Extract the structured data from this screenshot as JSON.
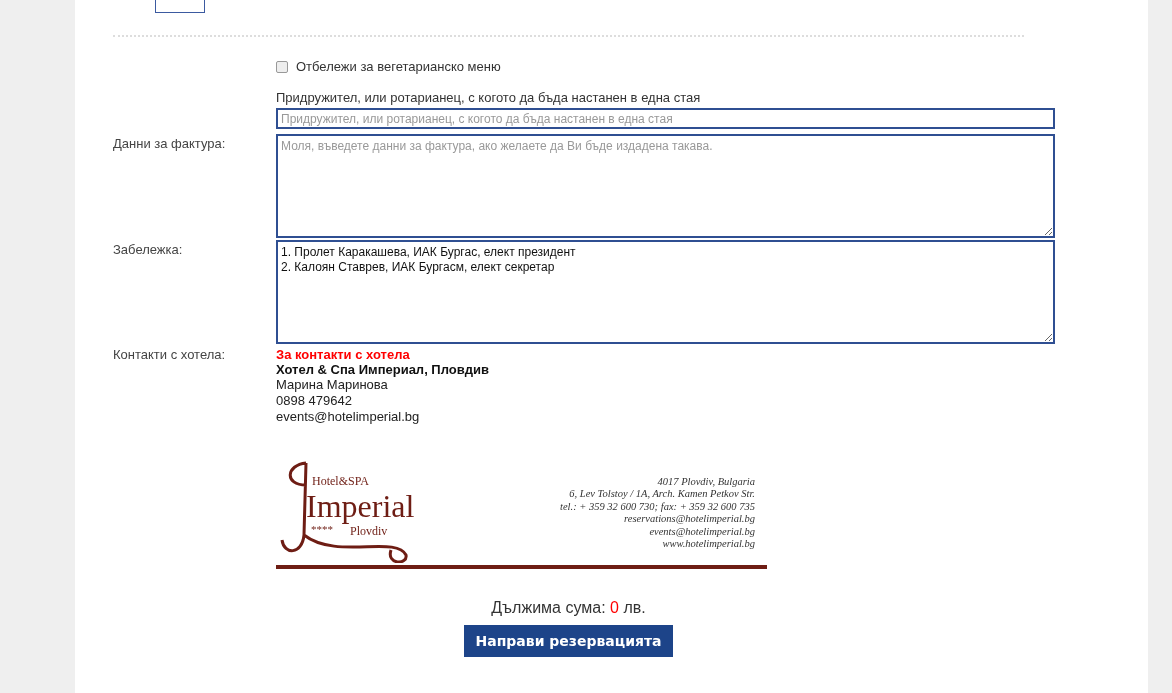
{
  "vegetarian": {
    "label": "Отбележи за вегетарианско меню",
    "checked": false
  },
  "roommate": {
    "label": "Придружител, или ротарианец, с когото да бъда настанен в една стая",
    "placeholder": "Придружител, или ротарианец, с когото да бъда настанен в една стая"
  },
  "invoice": {
    "label": "Данни за фактура:",
    "placeholder": "Моля, въведете данни за фактура, ако желаете да Ви бъде издадена такава."
  },
  "note": {
    "label": "Забележка:",
    "value": "1. Пролет Каракашева, ИАК Бургас, елект президент\n2. Калоян Ставрев, ИАК Бургасм, елект секретар"
  },
  "contacts": {
    "label": "Контакти с хотела:",
    "heading": "За контакти с хотела",
    "hotel": "Хотел & Спа Империал, Пловдив",
    "lines": [
      "Марина Маринова",
      "0898 479642",
      "events@hotelimperial.bg"
    ]
  },
  "logo": {
    "brand_top": "Hotel&SPA",
    "brand": "Imperial",
    "stars": "****",
    "city": "Plovdiv",
    "address": [
      "4017 Plovdiv, Bulgaria",
      "6, Lev Tolstoy / 1A, Arch. Kamen Petkov Str.",
      "tel.: + 359 32 600 730; fax: + 359 32 600 735",
      "reservations@hotelimperial.bg",
      "events@hotelimperial.bg",
      "www.hotelimperial.bg"
    ]
  },
  "total": {
    "label": "Дължима сума:",
    "amount": "0",
    "currency": "лв."
  },
  "submit": {
    "label": "Направи резервацията"
  }
}
